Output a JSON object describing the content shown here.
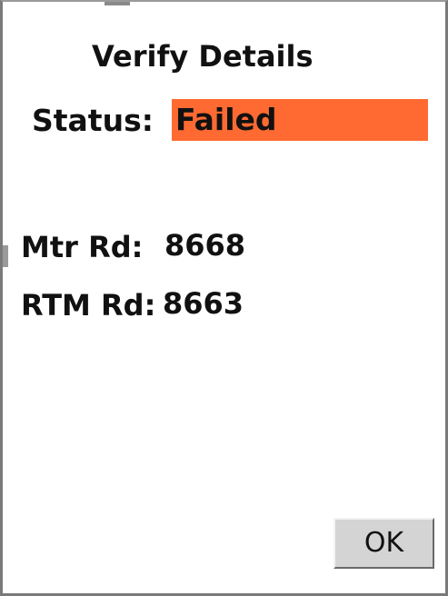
{
  "dialog": {
    "title": "Verify Details",
    "status": {
      "label": "Status:",
      "value": "Failed",
      "color": "#ff6a32"
    },
    "readings": [
      {
        "label": "Mtr Rd:",
        "value": "8668"
      },
      {
        "label": "RTM Rd:",
        "value": "8663"
      }
    ],
    "ok_label": "OK"
  }
}
